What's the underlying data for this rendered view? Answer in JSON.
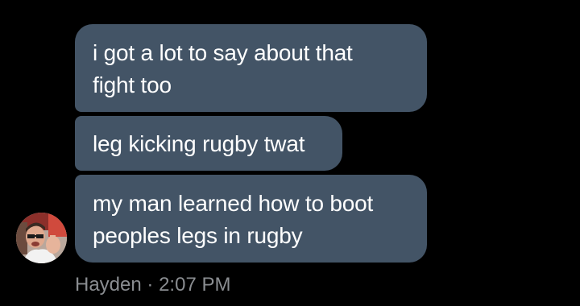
{
  "messages": [
    {
      "text": "i got a lot to say about that\nfight too"
    },
    {
      "text": "leg kicking rugby twat"
    },
    {
      "text": "my man learned how to boot\npeoples legs in rugby"
    }
  ],
  "sender": {
    "name": "Hayden",
    "separator": "·",
    "time": "2:07 PM"
  },
  "colors": {
    "background": "#000000",
    "bubble": "#435466",
    "bubble_text": "#ffffff",
    "meta_text": "#8a8d91"
  }
}
